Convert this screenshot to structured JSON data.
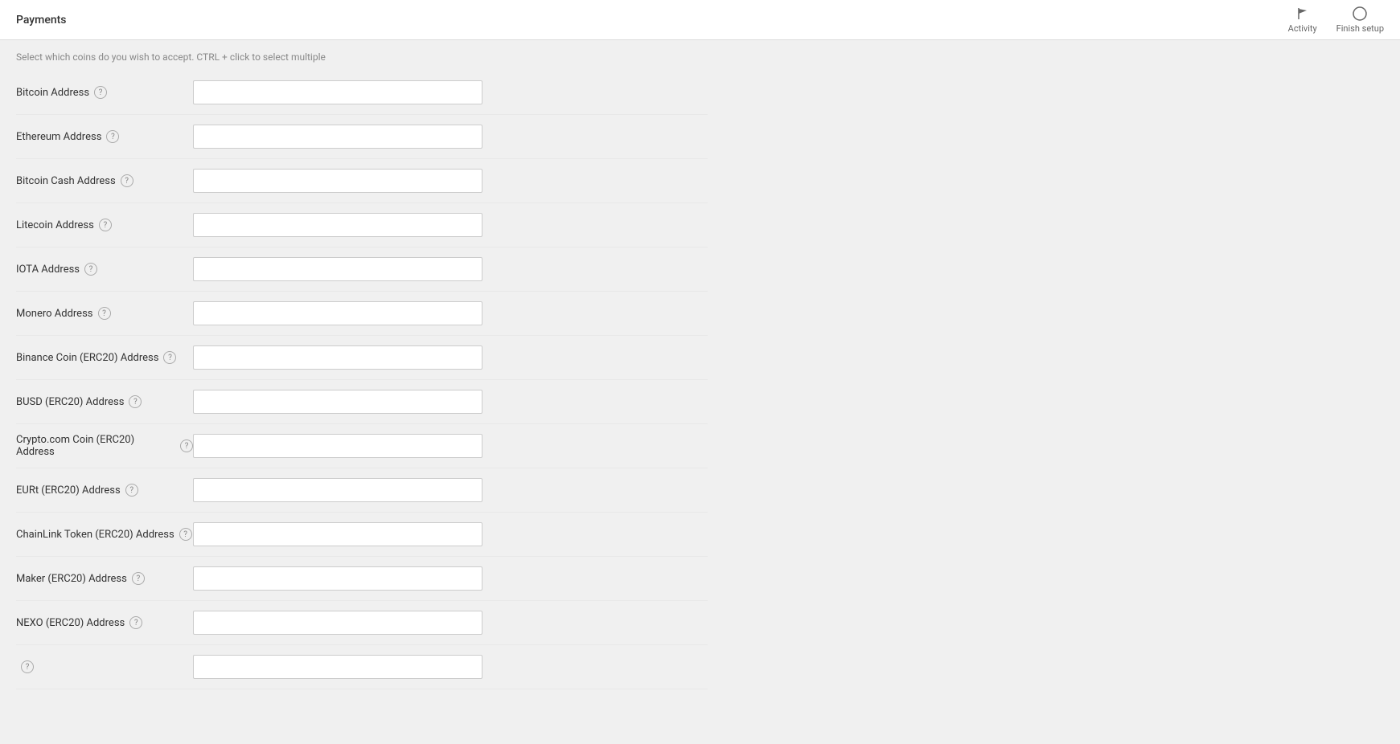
{
  "topbar": {
    "title": "Payments",
    "activity_label": "Activity",
    "finish_setup_label": "Finish setup"
  },
  "subtitle": "Select which coins do you wish to accept. CTRL + click to select multiple",
  "form_fields": [
    {
      "id": "bitcoin-address",
      "label": "Bitcoin Address",
      "placeholder": ""
    },
    {
      "id": "ethereum-address",
      "label": "Ethereum Address",
      "placeholder": ""
    },
    {
      "id": "bitcoin-cash-address",
      "label": "Bitcoin Cash Address",
      "placeholder": ""
    },
    {
      "id": "litecoin-address",
      "label": "Litecoin Address",
      "placeholder": ""
    },
    {
      "id": "iota-address",
      "label": "IOTA Address",
      "placeholder": ""
    },
    {
      "id": "monero-address",
      "label": "Monero Address",
      "placeholder": ""
    },
    {
      "id": "binance-coin-erc20-address",
      "label": "Binance Coin (ERC20) Address",
      "placeholder": ""
    },
    {
      "id": "busd-erc20-address",
      "label": "BUSD (ERC20) Address",
      "placeholder": ""
    },
    {
      "id": "crypto-com-coin-erc20-address",
      "label": "Crypto.com Coin (ERC20) Address",
      "placeholder": ""
    },
    {
      "id": "eurt-erc20-address",
      "label": "EURt (ERC20) Address",
      "placeholder": ""
    },
    {
      "id": "chainlink-token-erc20-address",
      "label": "ChainLink Token (ERC20) Address",
      "placeholder": ""
    },
    {
      "id": "maker-erc20-address",
      "label": "Maker (ERC20) Address",
      "placeholder": ""
    },
    {
      "id": "nexo-erc20-address",
      "label": "NEXO (ERC20) Address",
      "placeholder": ""
    },
    {
      "id": "unknown-erc20-address",
      "label": "",
      "placeholder": ""
    }
  ],
  "icons": {
    "flag": "⚑",
    "circle": "○",
    "help": "?"
  }
}
